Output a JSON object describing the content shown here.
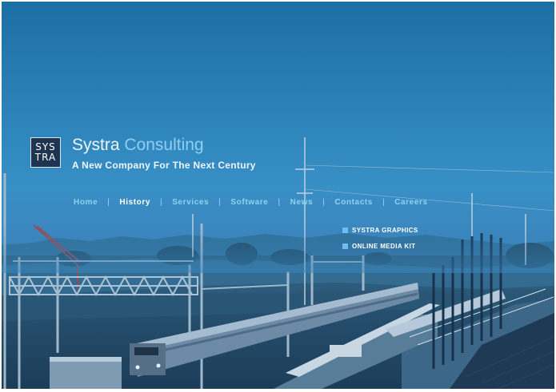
{
  "logo": {
    "line1": "SYS",
    "line2": "TRA"
  },
  "brand": {
    "name": "Systra",
    "suffix": "Consulting"
  },
  "tagline": "A New Company For The Next Century",
  "nav": {
    "home": "Home",
    "history": "History",
    "services": "Services",
    "software": "Software",
    "news": "News",
    "contacts": "Contacts",
    "careers": "Careers",
    "separator": "|"
  },
  "quick_links": {
    "graphics": "SYSTRA GRAPHICS",
    "media_kit": "ONLINE MEDIA KIT"
  },
  "colors": {
    "sky": "#2a80b6",
    "nav_link": "#8fd1f3",
    "nav_active": "#ffffff",
    "bullet": "#6fbcf0"
  }
}
